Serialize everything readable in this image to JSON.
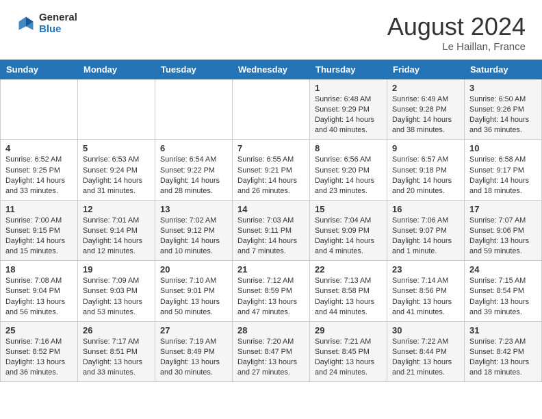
{
  "header": {
    "logo_general": "General",
    "logo_blue": "Blue",
    "month_title": "August 2024",
    "location": "Le Haillan, France"
  },
  "calendar": {
    "headers": [
      "Sunday",
      "Monday",
      "Tuesday",
      "Wednesday",
      "Thursday",
      "Friday",
      "Saturday"
    ],
    "weeks": [
      [
        {
          "day": "",
          "info": ""
        },
        {
          "day": "",
          "info": ""
        },
        {
          "day": "",
          "info": ""
        },
        {
          "day": "",
          "info": ""
        },
        {
          "day": "1",
          "info": "Sunrise: 6:48 AM\nSunset: 9:29 PM\nDaylight: 14 hours\nand 40 minutes."
        },
        {
          "day": "2",
          "info": "Sunrise: 6:49 AM\nSunset: 9:28 PM\nDaylight: 14 hours\nand 38 minutes."
        },
        {
          "day": "3",
          "info": "Sunrise: 6:50 AM\nSunset: 9:26 PM\nDaylight: 14 hours\nand 36 minutes."
        }
      ],
      [
        {
          "day": "4",
          "info": "Sunrise: 6:52 AM\nSunset: 9:25 PM\nDaylight: 14 hours\nand 33 minutes."
        },
        {
          "day": "5",
          "info": "Sunrise: 6:53 AM\nSunset: 9:24 PM\nDaylight: 14 hours\nand 31 minutes."
        },
        {
          "day": "6",
          "info": "Sunrise: 6:54 AM\nSunset: 9:22 PM\nDaylight: 14 hours\nand 28 minutes."
        },
        {
          "day": "7",
          "info": "Sunrise: 6:55 AM\nSunset: 9:21 PM\nDaylight: 14 hours\nand 26 minutes."
        },
        {
          "day": "8",
          "info": "Sunrise: 6:56 AM\nSunset: 9:20 PM\nDaylight: 14 hours\nand 23 minutes."
        },
        {
          "day": "9",
          "info": "Sunrise: 6:57 AM\nSunset: 9:18 PM\nDaylight: 14 hours\nand 20 minutes."
        },
        {
          "day": "10",
          "info": "Sunrise: 6:58 AM\nSunset: 9:17 PM\nDaylight: 14 hours\nand 18 minutes."
        }
      ],
      [
        {
          "day": "11",
          "info": "Sunrise: 7:00 AM\nSunset: 9:15 PM\nDaylight: 14 hours\nand 15 minutes."
        },
        {
          "day": "12",
          "info": "Sunrise: 7:01 AM\nSunset: 9:14 PM\nDaylight: 14 hours\nand 12 minutes."
        },
        {
          "day": "13",
          "info": "Sunrise: 7:02 AM\nSunset: 9:12 PM\nDaylight: 14 hours\nand 10 minutes."
        },
        {
          "day": "14",
          "info": "Sunrise: 7:03 AM\nSunset: 9:11 PM\nDaylight: 14 hours\nand 7 minutes."
        },
        {
          "day": "15",
          "info": "Sunrise: 7:04 AM\nSunset: 9:09 PM\nDaylight: 14 hours\nand 4 minutes."
        },
        {
          "day": "16",
          "info": "Sunrise: 7:06 AM\nSunset: 9:07 PM\nDaylight: 14 hours\nand 1 minute."
        },
        {
          "day": "17",
          "info": "Sunrise: 7:07 AM\nSunset: 9:06 PM\nDaylight: 13 hours\nand 59 minutes."
        }
      ],
      [
        {
          "day": "18",
          "info": "Sunrise: 7:08 AM\nSunset: 9:04 PM\nDaylight: 13 hours\nand 56 minutes."
        },
        {
          "day": "19",
          "info": "Sunrise: 7:09 AM\nSunset: 9:03 PM\nDaylight: 13 hours\nand 53 minutes."
        },
        {
          "day": "20",
          "info": "Sunrise: 7:10 AM\nSunset: 9:01 PM\nDaylight: 13 hours\nand 50 minutes."
        },
        {
          "day": "21",
          "info": "Sunrise: 7:12 AM\nSunset: 8:59 PM\nDaylight: 13 hours\nand 47 minutes."
        },
        {
          "day": "22",
          "info": "Sunrise: 7:13 AM\nSunset: 8:58 PM\nDaylight: 13 hours\nand 44 minutes."
        },
        {
          "day": "23",
          "info": "Sunrise: 7:14 AM\nSunset: 8:56 PM\nDaylight: 13 hours\nand 41 minutes."
        },
        {
          "day": "24",
          "info": "Sunrise: 7:15 AM\nSunset: 8:54 PM\nDaylight: 13 hours\nand 39 minutes."
        }
      ],
      [
        {
          "day": "25",
          "info": "Sunrise: 7:16 AM\nSunset: 8:52 PM\nDaylight: 13 hours\nand 36 minutes."
        },
        {
          "day": "26",
          "info": "Sunrise: 7:17 AM\nSunset: 8:51 PM\nDaylight: 13 hours\nand 33 minutes."
        },
        {
          "day": "27",
          "info": "Sunrise: 7:19 AM\nSunset: 8:49 PM\nDaylight: 13 hours\nand 30 minutes."
        },
        {
          "day": "28",
          "info": "Sunrise: 7:20 AM\nSunset: 8:47 PM\nDaylight: 13 hours\nand 27 minutes."
        },
        {
          "day": "29",
          "info": "Sunrise: 7:21 AM\nSunset: 8:45 PM\nDaylight: 13 hours\nand 24 minutes."
        },
        {
          "day": "30",
          "info": "Sunrise: 7:22 AM\nSunset: 8:44 PM\nDaylight: 13 hours\nand 21 minutes."
        },
        {
          "day": "31",
          "info": "Sunrise: 7:23 AM\nSunset: 8:42 PM\nDaylight: 13 hours\nand 18 minutes."
        }
      ]
    ]
  }
}
